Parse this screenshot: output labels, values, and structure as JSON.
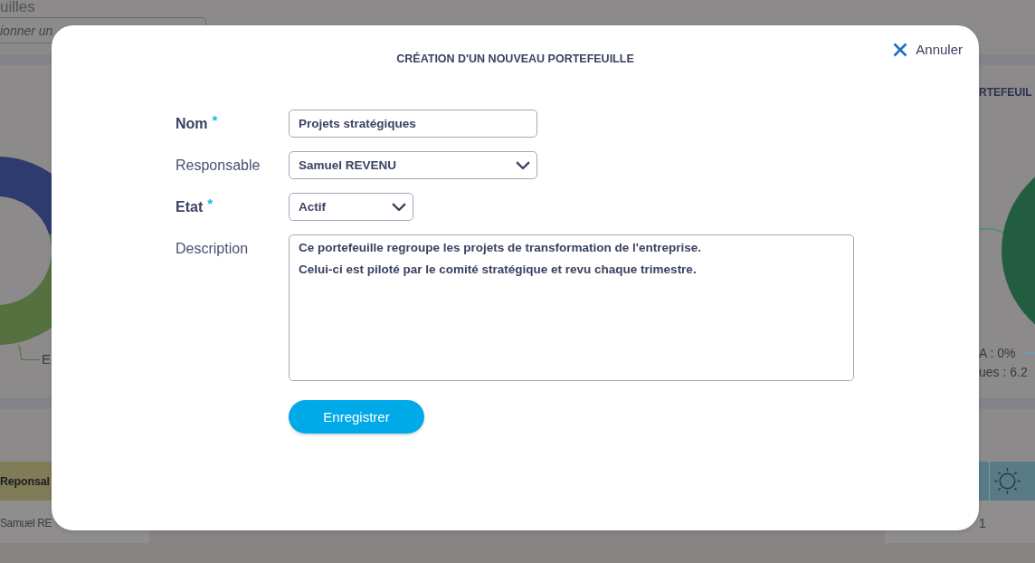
{
  "background": {
    "page_title": "uilles",
    "search": {
      "placeholder": "ionner un"
    },
    "left_chart": {
      "label": "E"
    },
    "right_chart": {
      "title": "RTEFEUIL",
      "labels": [
        "A : 0%",
        "ues : 6.2"
      ]
    },
    "table": {
      "columns": [
        "Reponsal"
      ],
      "rows": [
        [
          "Samuel RE",
          "1"
        ]
      ]
    }
  },
  "dialog": {
    "title": "CRÉATION D'UN NOUVEAU PORTEFEUILLE",
    "cancel": "Annuler",
    "fields": [
      {
        "kind": "text",
        "label": "Nom",
        "required": true,
        "mark": "*",
        "value": "Projets stratégiques"
      },
      {
        "kind": "select",
        "label": "Responsable",
        "required": false,
        "value": "Samuel REVENU"
      },
      {
        "kind": "select",
        "label": "Etat",
        "required": true,
        "mark": "*",
        "value": "Actif"
      },
      {
        "kind": "textarea",
        "label": "Description",
        "required": false,
        "value": "Ce portefeuille regroupe les projets de transformation de l'entreprise.\nCelui-ci est piloté par le comité stratégique et revu chaque trimestre."
      }
    ],
    "submit": "Enregistrer"
  }
}
